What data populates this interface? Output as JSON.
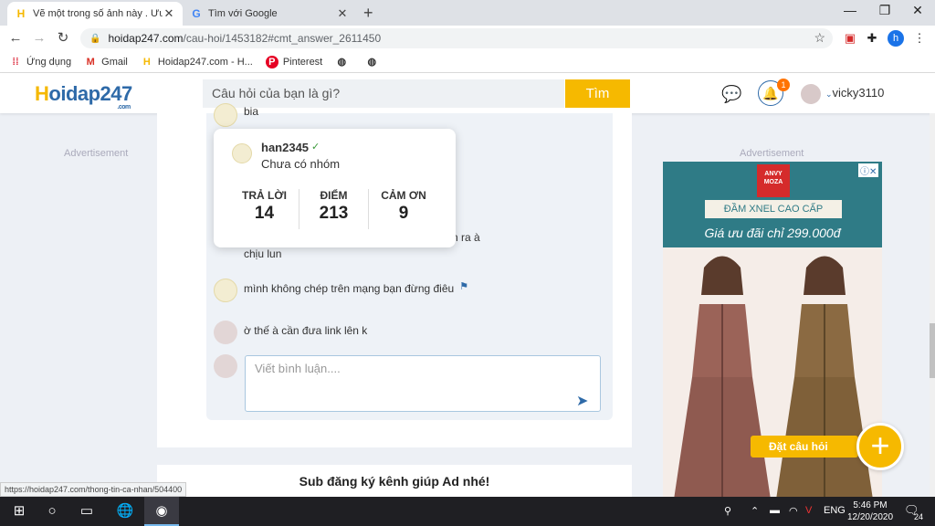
{
  "browser": {
    "tabs": [
      {
        "title": "Vẽ một trong số ảnh này . Ưu tiê",
        "active": true
      },
      {
        "title": "Tìm với Google",
        "active": false
      }
    ],
    "url_host": "hoidap247.com",
    "url_path": "/cau-hoi/1453182#cmt_answer_2611450",
    "profile_letter": "h",
    "bookmarks": [
      "Ứng dụng",
      "Gmail",
      "Hoidap247.com - H...",
      "Pinterest"
    ],
    "status_url": "https://hoidap247.com/thong-tin-ca-nhan/504400"
  },
  "site": {
    "logo_h": "H",
    "logo_rest": "oidap247",
    "logo_com": ".com",
    "search_placeholder": "Câu hỏi của bạn là gì?",
    "search_button": "Tìm",
    "notification_count": "1",
    "username": "vicky3110"
  },
  "ads": {
    "left_label": "Advertisement",
    "right_label": "Advertisement",
    "brand": "ANVY MOZA",
    "banner": "ĐẦM XNEL CAO CẤP",
    "price": "Giá ưu đãi chỉ 299.000đ"
  },
  "comments": [
    {
      "text": "bia",
      "partial": true
    },
    {
      "text": "n ra à",
      "partial": true
    },
    {
      "text": "chịu lun",
      "partial": true
    },
    {
      "text": "mình không chép trên mạng bạn đừng điêu",
      "flag": true
    },
    {
      "text": "ờ thế à cần đưa link lên k"
    }
  ],
  "reply_placeholder": "Viết bình luận....",
  "profile_popup": {
    "name": "han2345",
    "group": "Chưa có nhóm",
    "stats": [
      {
        "label": "TRẢ LỜI",
        "value": "14"
      },
      {
        "label": "ĐIỂM",
        "value": "213"
      },
      {
        "label": "CẢM ƠN",
        "value": "9"
      }
    ]
  },
  "sub_card_text": "Sub đăng ký kênh giúp Ad nhé!",
  "ask_button": "Đặt câu hỏi",
  "taskbar": {
    "lang": "ENG",
    "time": "5:46 PM",
    "date": "12/20/2020",
    "notif_count": "24"
  }
}
